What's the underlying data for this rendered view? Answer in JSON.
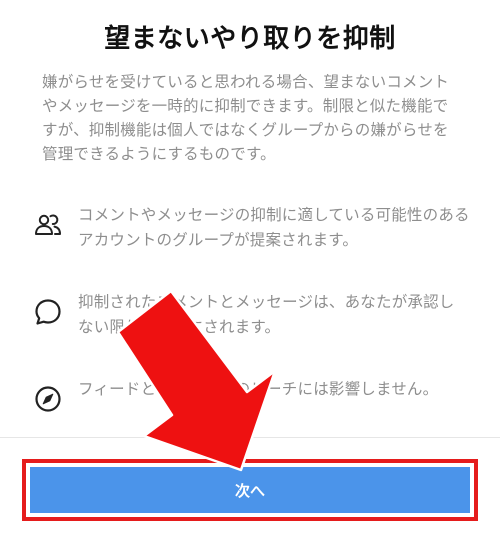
{
  "title": "望まないやり取りを抑制",
  "intro": "嫌がらせを受けていると思われる場合、望まないコメントやメッセージを一時的に抑制できます。制限と似た機能ですが、抑制機能は個人ではなくグループからの嫌がらせを管理できるようにするものです。",
  "features": [
    {
      "icon": "people-group-icon",
      "text": "コメントやメッセージの抑制に適している可能性のあるアカウントのグループが提案されます。"
    },
    {
      "icon": "speech-bubble-icon",
      "text": "抑制されたコメントとメッセージは、あなたが承認しない限り非表示にされます。"
    },
    {
      "icon": "compass-icon",
      "text": "フィードとストーリーのリーチには影響しません。"
    }
  ],
  "next_button": "次へ",
  "colors": {
    "button_blue": "#4b94ea",
    "highlight_red": "#e51c1c",
    "arrow_red": "#ee1111",
    "muted_text": "#8e8e8e"
  },
  "annotation": {
    "arrow": "red-arrow-pointing-to-next-button",
    "highlight": "red-box-around-next-button"
  }
}
